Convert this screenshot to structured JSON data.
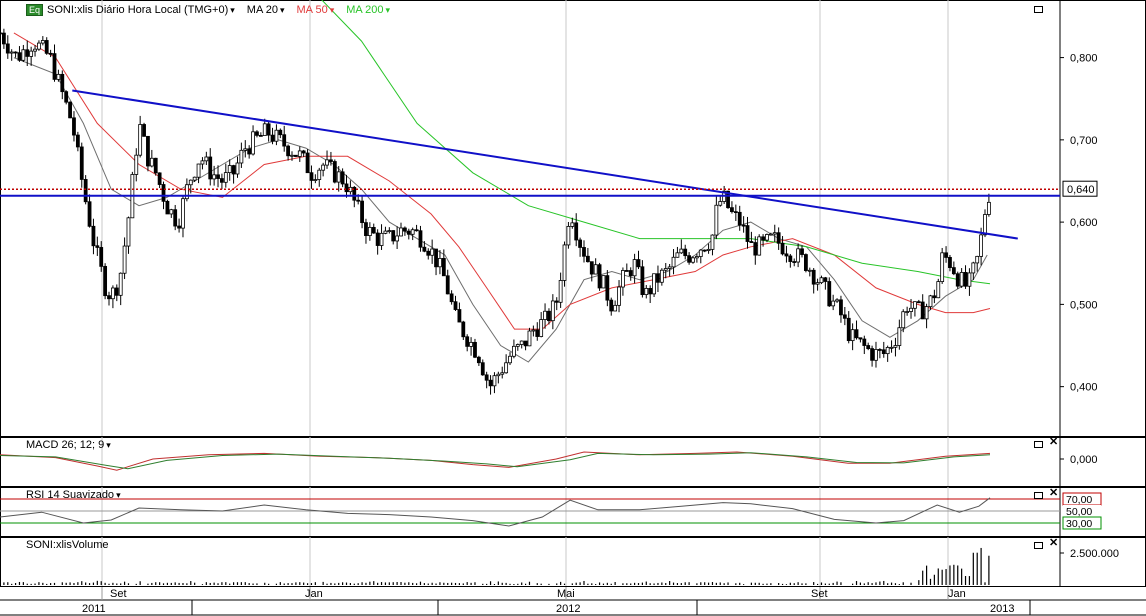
{
  "header": {
    "symbol_badge": "Eq",
    "title": "SONI:xlis Diário Hora Local (TMG+0)",
    "ma20_label": "MA 20",
    "ma50_label": "MA 50",
    "ma200_label": "MA 200"
  },
  "panels": {
    "macd_label": "MACD 26; 12; 9",
    "rsi_label": "RSI 14 Suavizado",
    "volume_label": "SONI:xlisVolume"
  },
  "colors": {
    "ma20": "#6e6e6e",
    "ma50": "#e03a3a",
    "ma200": "#28c428",
    "trendline": "#1010c8",
    "resistance": "#1010c8",
    "price_marker": "#c00000",
    "rsi_70": "#c00000",
    "rsi_30": "#009000",
    "macd_line": "#c03030",
    "signal_line": "#2f7f2f"
  },
  "chart_data": [
    {
      "type": "candlestick",
      "title": "SONI:xlis Diário Hora Local (TMG+0)",
      "y_ticks": [
        "0,800",
        "0,700",
        "0,600",
        "0,500",
        "0,400"
      ],
      "last_price_label": "0,640",
      "x_ticks": [
        "Set",
        "Jan",
        "Mai",
        "Set",
        "Jan"
      ],
      "year_labels": [
        "2011",
        "2012",
        "2013"
      ],
      "ylim": [
        0.34,
        0.87
      ],
      "close_path": [
        [
          0,
          0.83
        ],
        [
          6,
          0.8
        ],
        [
          12,
          0.82
        ],
        [
          18,
          0.8
        ],
        [
          22,
          0.76
        ],
        [
          26,
          0.72
        ],
        [
          30,
          0.64
        ],
        [
          34,
          0.57
        ],
        [
          38,
          0.52
        ],
        [
          40,
          0.51
        ],
        [
          43,
          0.53
        ],
        [
          46,
          0.6
        ],
        [
          48,
          0.66
        ],
        [
          50,
          0.72
        ],
        [
          53,
          0.68
        ],
        [
          56,
          0.66
        ],
        [
          60,
          0.62
        ],
        [
          64,
          0.6
        ],
        [
          68,
          0.65
        ],
        [
          72,
          0.68
        ],
        [
          76,
          0.66
        ],
        [
          80,
          0.65
        ],
        [
          84,
          0.66
        ],
        [
          88,
          0.69
        ],
        [
          92,
          0.7
        ],
        [
          96,
          0.71
        ],
        [
          100,
          0.7
        ],
        [
          104,
          0.69
        ],
        [
          108,
          0.68
        ],
        [
          112,
          0.66
        ],
        [
          116,
          0.67
        ],
        [
          120,
          0.66
        ],
        [
          124,
          0.65
        ],
        [
          128,
          0.62
        ],
        [
          132,
          0.59
        ],
        [
          136,
          0.58
        ],
        [
          140,
          0.58
        ],
        [
          144,
          0.59
        ],
        [
          148,
          0.59
        ],
        [
          152,
          0.58
        ],
        [
          156,
          0.56
        ],
        [
          160,
          0.53
        ],
        [
          164,
          0.48
        ],
        [
          168,
          0.46
        ],
        [
          172,
          0.44
        ],
        [
          176,
          0.4
        ],
        [
          180,
          0.42
        ],
        [
          184,
          0.44
        ],
        [
          188,
          0.45
        ],
        [
          192,
          0.47
        ],
        [
          196,
          0.48
        ],
        [
          200,
          0.5
        ],
        [
          203,
          0.57
        ],
        [
          205,
          0.62
        ],
        [
          208,
          0.58
        ],
        [
          212,
          0.55
        ],
        [
          216,
          0.53
        ],
        [
          220,
          0.5
        ],
        [
          224,
          0.53
        ],
        [
          228,
          0.55
        ],
        [
          232,
          0.51
        ],
        [
          236,
          0.53
        ],
        [
          240,
          0.54
        ],
        [
          244,
          0.56
        ],
        [
          248,
          0.56
        ],
        [
          252,
          0.57
        ],
        [
          256,
          0.58
        ],
        [
          258,
          0.62
        ],
        [
          260,
          0.63
        ],
        [
          263,
          0.61
        ],
        [
          266,
          0.6
        ],
        [
          270,
          0.57
        ],
        [
          274,
          0.57
        ],
        [
          278,
          0.58
        ],
        [
          282,
          0.57
        ],
        [
          286,
          0.56
        ],
        [
          290,
          0.55
        ],
        [
          294,
          0.53
        ],
        [
          298,
          0.51
        ],
        [
          302,
          0.49
        ],
        [
          306,
          0.46
        ],
        [
          310,
          0.45
        ],
        [
          314,
          0.44
        ],
        [
          318,
          0.44
        ],
        [
          322,
          0.46
        ],
        [
          326,
          0.5
        ],
        [
          330,
          0.49
        ],
        [
          334,
          0.5
        ],
        [
          337,
          0.52
        ],
        [
          339,
          0.56
        ],
        [
          342,
          0.55
        ],
        [
          345,
          0.53
        ],
        [
          348,
          0.52
        ],
        [
          350,
          0.54
        ],
        [
          352,
          0.56
        ],
        [
          354,
          0.61
        ],
        [
          356,
          0.64
        ]
      ],
      "series": [
        {
          "name": "MA 20",
          "path": [
            [
              5,
              0.8
            ],
            [
              20,
              0.78
            ],
            [
              30,
              0.72
            ],
            [
              40,
              0.64
            ],
            [
              50,
              0.62
            ],
            [
              60,
              0.63
            ],
            [
              70,
              0.65
            ],
            [
              80,
              0.67
            ],
            [
              90,
              0.69
            ],
            [
              100,
              0.7
            ],
            [
              110,
              0.69
            ],
            [
              120,
              0.67
            ],
            [
              130,
              0.64
            ],
            [
              140,
              0.6
            ],
            [
              150,
              0.58
            ],
            [
              160,
              0.56
            ],
            [
              170,
              0.5
            ],
            [
              180,
              0.45
            ],
            [
              190,
              0.43
            ],
            [
              200,
              0.47
            ],
            [
              210,
              0.53
            ],
            [
              220,
              0.54
            ],
            [
              230,
              0.53
            ],
            [
              240,
              0.54
            ],
            [
              250,
              0.56
            ],
            [
              260,
              0.59
            ],
            [
              270,
              0.6
            ],
            [
              280,
              0.58
            ],
            [
              290,
              0.57
            ],
            [
              300,
              0.53
            ],
            [
              310,
              0.48
            ],
            [
              320,
              0.46
            ],
            [
              330,
              0.48
            ],
            [
              340,
              0.51
            ],
            [
              350,
              0.53
            ],
            [
              355,
              0.56
            ]
          ]
        },
        {
          "name": "MA 50",
          "path": [
            [
              5,
              0.83
            ],
            [
              20,
              0.8
            ],
            [
              35,
              0.72
            ],
            [
              50,
              0.67
            ],
            [
              65,
              0.64
            ],
            [
              80,
              0.63
            ],
            [
              95,
              0.67
            ],
            [
              110,
              0.68
            ],
            [
              125,
              0.68
            ],
            [
              140,
              0.65
            ],
            [
              155,
              0.61
            ],
            [
              165,
              0.57
            ],
            [
              175,
              0.52
            ],
            [
              185,
              0.47
            ],
            [
              195,
              0.47
            ],
            [
              205,
              0.5
            ],
            [
              220,
              0.52
            ],
            [
              235,
              0.53
            ],
            [
              250,
              0.54
            ],
            [
              260,
              0.56
            ],
            [
              270,
              0.57
            ],
            [
              285,
              0.58
            ],
            [
              300,
              0.56
            ],
            [
              315,
              0.52
            ],
            [
              330,
              0.5
            ],
            [
              340,
              0.49
            ],
            [
              350,
              0.49
            ],
            [
              356,
              0.495
            ]
          ]
        },
        {
          "name": "MA 200",
          "path": [
            [
              110,
              0.89
            ],
            [
              130,
              0.82
            ],
            [
              150,
              0.72
            ],
            [
              170,
              0.66
            ],
            [
              190,
              0.62
            ],
            [
              210,
              0.6
            ],
            [
              230,
              0.58
            ],
            [
              250,
              0.58
            ],
            [
              270,
              0.58
            ],
            [
              290,
              0.57
            ],
            [
              310,
              0.55
            ],
            [
              330,
              0.54
            ],
            [
              345,
              0.53
            ],
            [
              356,
              0.525
            ]
          ]
        }
      ],
      "trendline": {
        "from": [
          26,
          0.76
        ],
        "to": [
          366,
          0.58
        ]
      },
      "resistance_level": 0.632,
      "marker_level": 0.64
    },
    {
      "type": "line",
      "title": "MACD 26; 12; 9",
      "y_ticks": [
        "0,000"
      ],
      "series": [
        {
          "name": "MACD",
          "path": [
            [
              0,
              0.3
            ],
            [
              20,
              0.1
            ],
            [
              35,
              -0.5
            ],
            [
              42,
              -0.8
            ],
            [
              55,
              0.0
            ],
            [
              75,
              0.3
            ],
            [
              95,
              0.4
            ],
            [
              115,
              0.2
            ],
            [
              135,
              0.1
            ],
            [
              155,
              -0.1
            ],
            [
              170,
              -0.4
            ],
            [
              183,
              -0.6
            ],
            [
              200,
              0.0
            ],
            [
              210,
              0.5
            ],
            [
              230,
              0.3
            ],
            [
              250,
              0.4
            ],
            [
              265,
              0.5
            ],
            [
              285,
              0.2
            ],
            [
              305,
              -0.3
            ],
            [
              320,
              -0.3
            ],
            [
              340,
              0.2
            ],
            [
              356,
              0.4
            ]
          ]
        },
        {
          "name": "Signal",
          "path": [
            [
              0,
              0.25
            ],
            [
              20,
              0.15
            ],
            [
              38,
              -0.45
            ],
            [
              46,
              -0.7
            ],
            [
              60,
              -0.1
            ],
            [
              80,
              0.25
            ],
            [
              100,
              0.35
            ],
            [
              120,
              0.2
            ],
            [
              140,
              0.05
            ],
            [
              160,
              -0.15
            ],
            [
              175,
              -0.35
            ],
            [
              186,
              -0.55
            ],
            [
              205,
              -0.05
            ],
            [
              215,
              0.4
            ],
            [
              235,
              0.3
            ],
            [
              255,
              0.35
            ],
            [
              270,
              0.45
            ],
            [
              290,
              0.15
            ],
            [
              308,
              -0.25
            ],
            [
              325,
              -0.28
            ],
            [
              343,
              0.15
            ],
            [
              356,
              0.3
            ]
          ]
        }
      ]
    },
    {
      "type": "line",
      "title": "RSI 14 Suavizado",
      "y_ticks": [
        "70,00",
        "50,00",
        "30,00"
      ],
      "levels": [
        70,
        50,
        30
      ],
      "series": [
        {
          "name": "RSI",
          "path": [
            [
              0,
              40
            ],
            [
              15,
              48
            ],
            [
              30,
              30
            ],
            [
              40,
              35
            ],
            [
              50,
              55
            ],
            [
              65,
              52
            ],
            [
              80,
              50
            ],
            [
              95,
              60
            ],
            [
              110,
              52
            ],
            [
              125,
              46
            ],
            [
              140,
              44
            ],
            [
              155,
              40
            ],
            [
              170,
              34
            ],
            [
              183,
              25
            ],
            [
              195,
              40
            ],
            [
              205,
              68
            ],
            [
              215,
              52
            ],
            [
              230,
              52
            ],
            [
              245,
              58
            ],
            [
              260,
              64
            ],
            [
              270,
              62
            ],
            [
              285,
              54
            ],
            [
              300,
              36
            ],
            [
              315,
              30
            ],
            [
              325,
              34
            ],
            [
              337,
              60
            ],
            [
              345,
              48
            ],
            [
              352,
              58
            ],
            [
              356,
              72
            ]
          ]
        }
      ]
    },
    {
      "type": "bar",
      "title": "SONI:xlisVolume",
      "y_ticks": [
        "2.500.000"
      ],
      "note": "sparse daily volume bars; spikes at right edge up to ~3.200.000"
    }
  ]
}
